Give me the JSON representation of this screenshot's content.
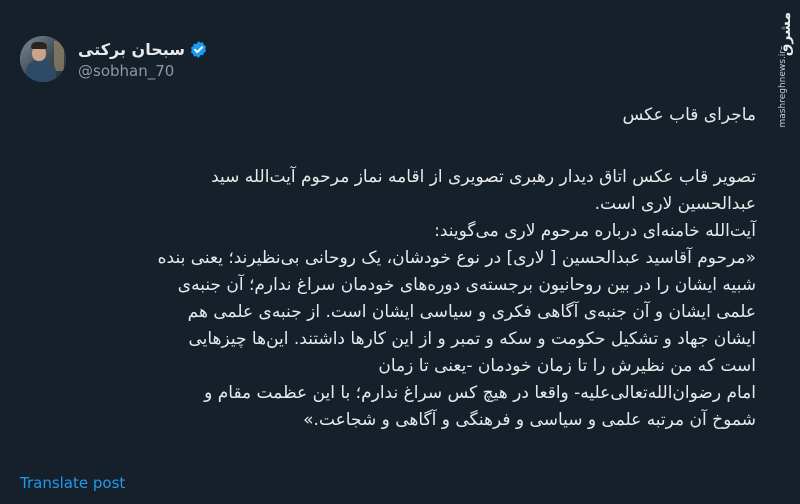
{
  "author": {
    "display_name": "سبحان برکتی",
    "handle": "@sobhan_70",
    "verified": true
  },
  "watermark": {
    "logo": "مشرق",
    "site": "mashreghnews.ir"
  },
  "post": {
    "title": "ماجرای قاب عکس",
    "lines": [
      "تصویر قاب عکس اتاق دیدار رهبری تصویری از اقامه نماز مرحوم آیت‌الله سید",
      "عبدالحسین لاری است.",
      "آیت‌الله خامنه‌ای درباره مرحوم لاری می‌گویند:",
      "«مرحوم آقاسید عبدالحسین [ لاری] در نوع خودشان، یک روحانی بی‌نظیرند؛ یعنی بنده",
      "شبیه ایشان را در بین روحانیون برجسته‌ی دوره‌های خودمان سراغ ندارم؛ آن جنبه‌ی",
      "علمی ایشان و آن جنبه‌ی آگاهی فکری و سیاسی ایشان است. از جنبه‌ی علمی هم",
      "ایشان جهاد و تشکیل حکومت و سکه و تمبر و از این کارها داشتند. این‌ها چیزهایی",
      "است که من نظیرش را تا زمان خودمان -یعنی تا زمان",
      "امام رضوان‌الله‌تعالی‌علیه- واقعا در هیچ کس سراغ ندارم؛ با این عظمت مقام و",
      "شموخ آن مرتبه علمی و سیاسی و فرهنگی و آگاهی و شجاعت.»"
    ]
  },
  "actions": {
    "translate_label": "Translate post"
  },
  "colors": {
    "background": "#15202b",
    "text": "#e7e9ea",
    "muted": "#8b98a5",
    "accent": "#1d9bf0"
  }
}
